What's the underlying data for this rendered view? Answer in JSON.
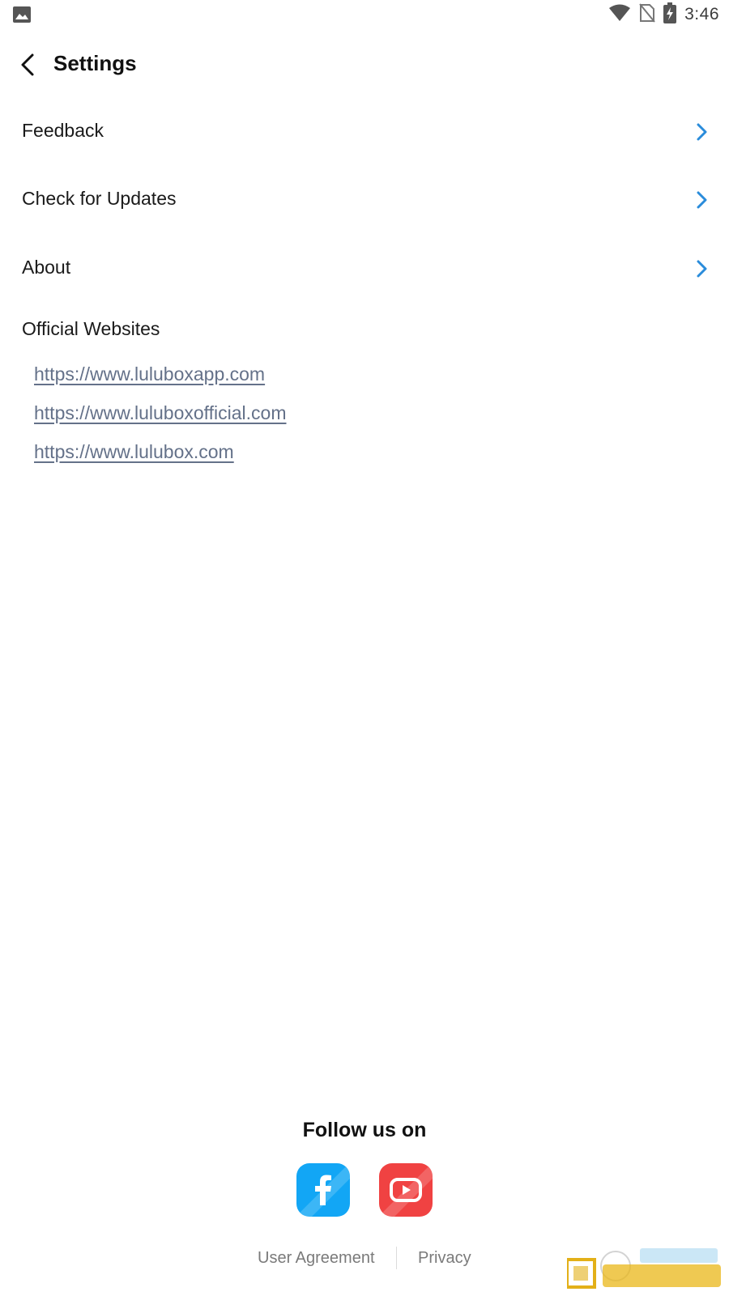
{
  "status_bar": {
    "time": "3:46",
    "icons": [
      "gallery-icon",
      "wifi-icon",
      "no-sim-icon",
      "battery-charging-icon"
    ]
  },
  "header": {
    "title": "Settings",
    "back_icon": "back-arrow-icon"
  },
  "menu": {
    "items": [
      {
        "label": "Feedback",
        "icon": "chevron-right-icon"
      },
      {
        "label": "Check for Updates",
        "icon": "chevron-right-icon"
      },
      {
        "label": "About",
        "icon": "chevron-right-icon"
      }
    ]
  },
  "websites": {
    "title": "Official Websites",
    "links": [
      "https://www.luluboxapp.com",
      "https://www.luluboxofficial.com",
      "https://www.lulubox.com"
    ]
  },
  "follow": {
    "title": "Follow us on",
    "networks": [
      {
        "icon": "facebook-icon",
        "color": "#12a6f5"
      },
      {
        "icon": "youtube-icon",
        "color": "#f04242"
      }
    ]
  },
  "footer": {
    "user_agreement": "User Agreement",
    "privacy": "Privacy"
  },
  "colors": {
    "accent_chevron": "#2a8cdb",
    "link": "#647189"
  }
}
